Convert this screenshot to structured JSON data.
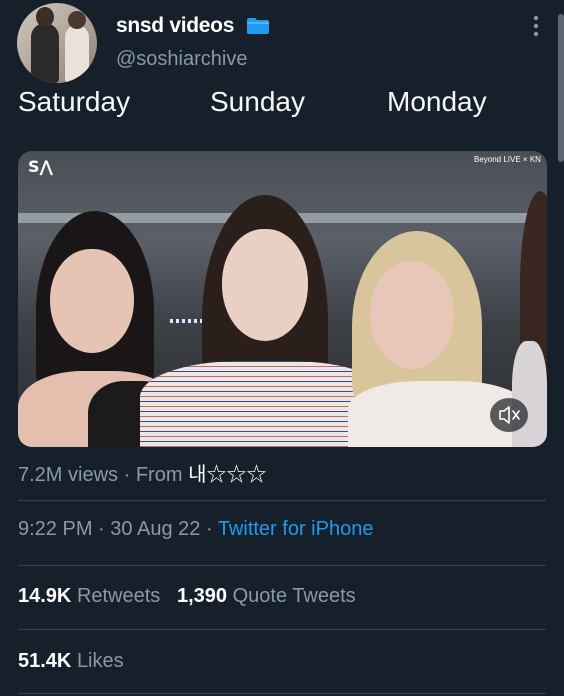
{
  "user": {
    "display_name": "snsd videos",
    "handle": "@soshiarchive"
  },
  "tweet": {
    "words": [
      "Saturday",
      "Sunday",
      "Monday"
    ]
  },
  "media": {
    "watermark": "S⋀",
    "live_badge": "Beyond LIVE × KN",
    "mute_icon": "speaker-muted-icon"
  },
  "views": {
    "count": "7.2M views",
    "separator": "·",
    "from_label": "From",
    "from_name": "내☆☆☆"
  },
  "timestamp": {
    "time": "9:22 PM",
    "separator": "·",
    "date": "30 Aug 22",
    "source": "Twitter for iPhone"
  },
  "engagement": {
    "retweets_count": "14.9K",
    "retweets_label": "Retweets",
    "quotes_count": "1,390",
    "quotes_label": "Quote Tweets",
    "likes_count": "51.4K",
    "likes_label": "Likes"
  },
  "colors": {
    "background": "#15202b",
    "muted_text": "#8b98a5",
    "link": "#1d9bf0",
    "folder_icon": "#1d9bf0"
  }
}
